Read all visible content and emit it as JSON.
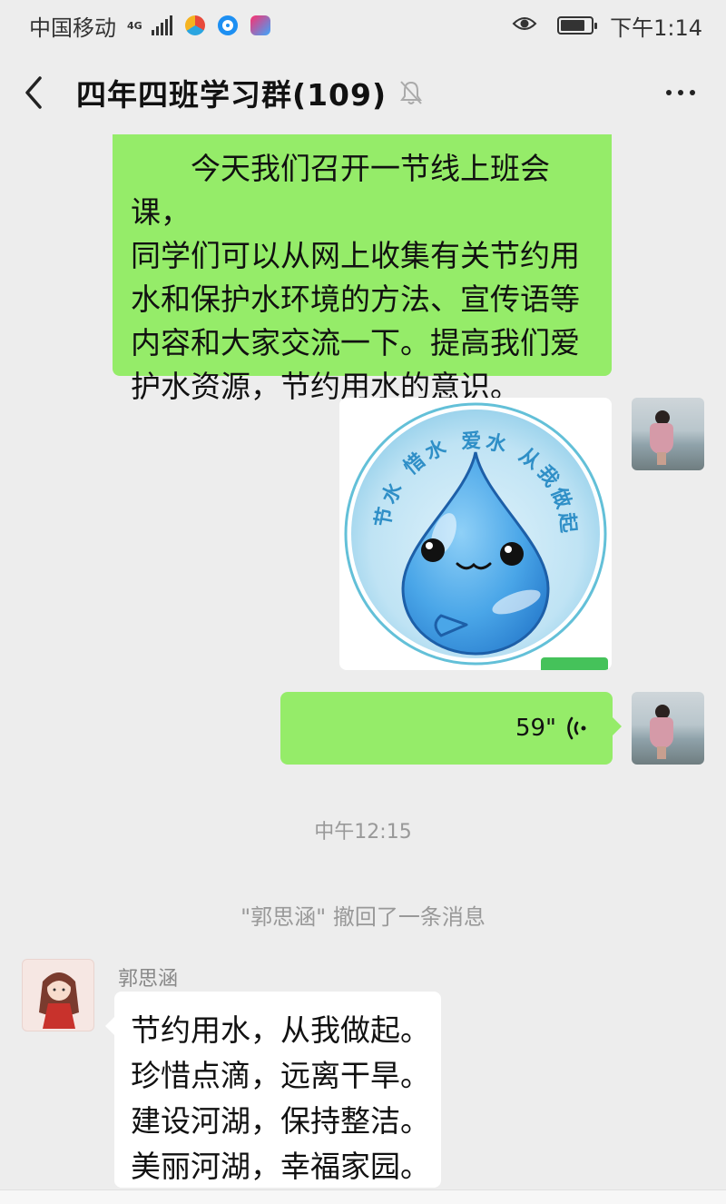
{
  "status_bar": {
    "carrier": "中国移动",
    "network": "4G",
    "time": "下午1:14",
    "icons": [
      "signal-icon",
      "app-icon",
      "app-icon",
      "youku-icon",
      "eye-icon",
      "battery-icon"
    ]
  },
  "header": {
    "title": "四年四班学习群(109)",
    "icons": [
      "back-icon",
      "mute-bell-icon",
      "more-icon"
    ]
  },
  "messages": {
    "outgoing_text": "　　今天我们召开一节线上班会课，\n同学们可以从网上收集有关节约用\n水和保护水环境的方法、宣传语等\n内容和大家交流一下。提高我们爱\n护水资源，节约用水的意识。",
    "image_caption_text": "节水 惜水 爱水 从我做起!",
    "voice_duration": "59\"",
    "time_divider": "中午12:15",
    "recall_notice": "\"郭思涵\" 撤回了一条消息",
    "sender_name": "郭思涵",
    "incoming_text": "节约用水，从我做起。\n珍惜点滴，远离干旱。\n建设河湖，保持整洁。\n美丽河湖，幸福家园。"
  },
  "colors": {
    "background": "#ededed",
    "bubble_outgoing": "#95ec69",
    "bubble_incoming": "#ffffff",
    "drop_blue": "#4aa6e8",
    "ring_teal": "#63c0d8"
  }
}
